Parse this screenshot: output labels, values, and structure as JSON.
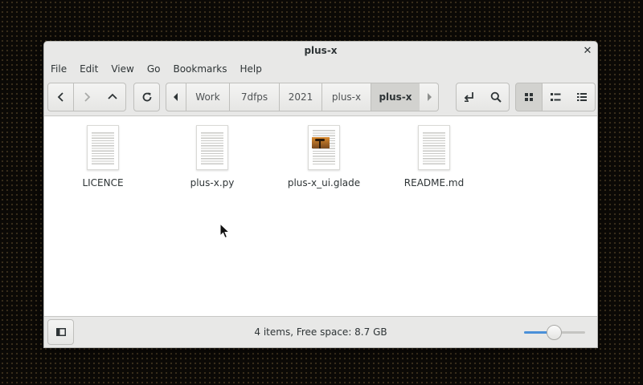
{
  "window": {
    "title": "plus-x"
  },
  "menu": [
    "File",
    "Edit",
    "View",
    "Go",
    "Bookmarks",
    "Help"
  ],
  "breadcrumbs": [
    "Work",
    "7dfps",
    "2021",
    "plus-x",
    "plus-x"
  ],
  "files": [
    {
      "name": "LICENCE",
      "icon": "text-document-icon"
    },
    {
      "name": "plus-x.py",
      "icon": "text-document-icon"
    },
    {
      "name": "plus-x_ui.glade",
      "icon": "image-preview-icon"
    },
    {
      "name": "README.md",
      "icon": "text-document-icon"
    }
  ],
  "status": {
    "text": "4 items, Free space: 8.7 GB"
  },
  "zoom": {
    "level": 0.5
  },
  "colors": {
    "accent": "#4a90d9"
  }
}
